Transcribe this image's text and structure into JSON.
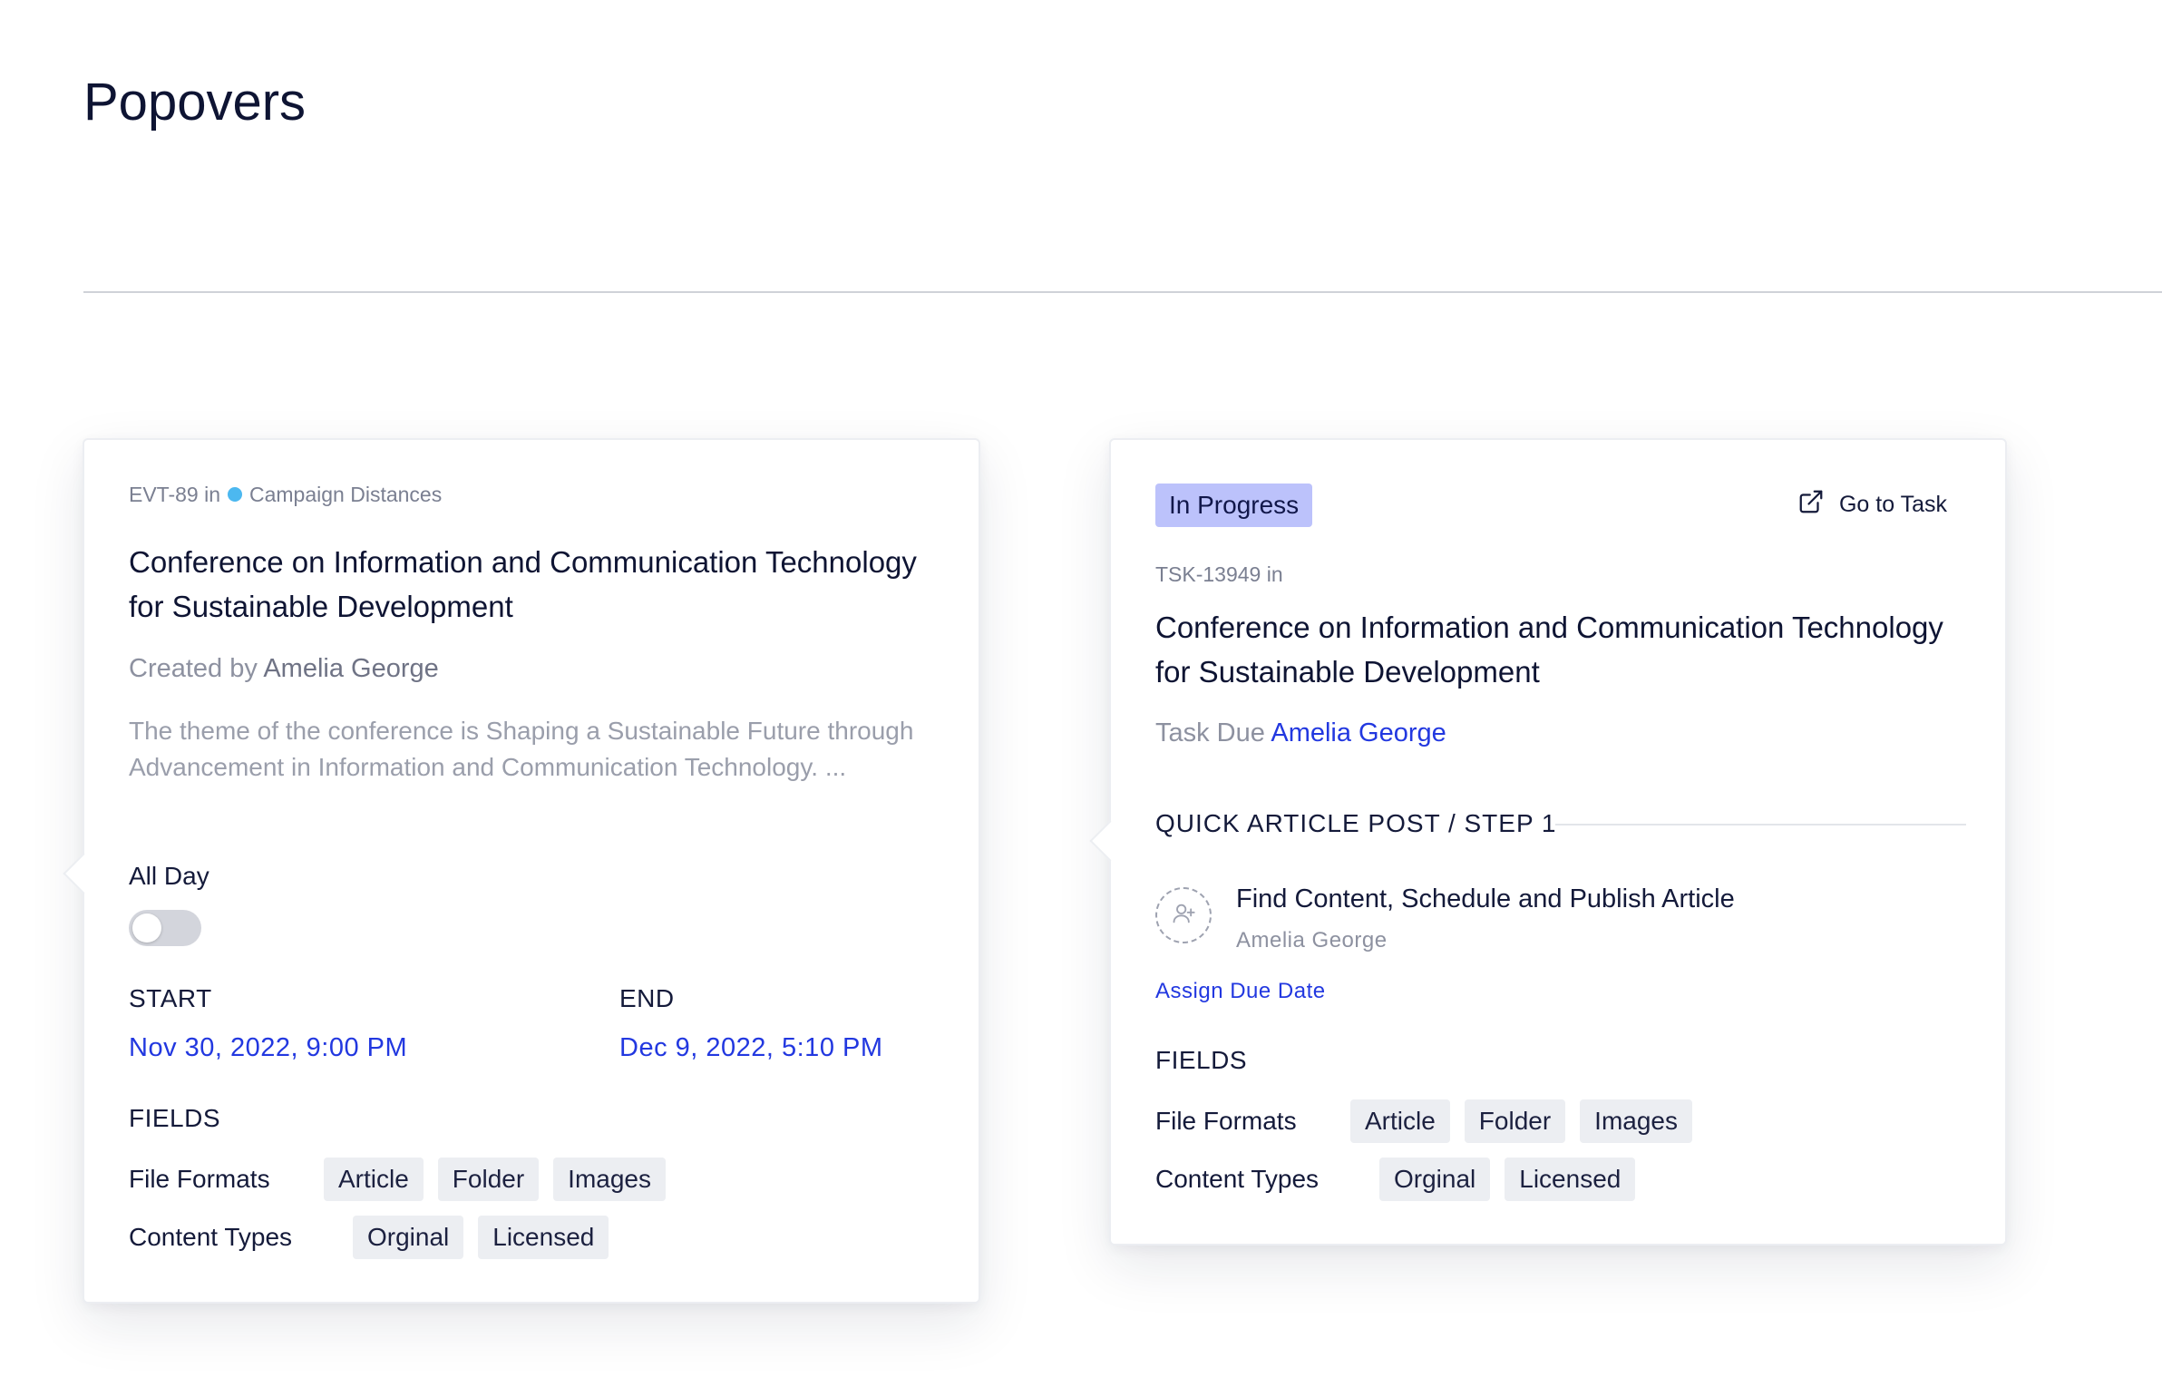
{
  "page": {
    "title": "Popovers"
  },
  "event_popover": {
    "event_id": "EVT-89 in",
    "campaign_name": "Campaign Distances",
    "campaign_color": "#4cb8f0",
    "title": "Conference on Information and Communication Technology for Sustainable Development",
    "created_by_label": "Created by",
    "created_by_name": "Amelia George",
    "description": "The theme of the conference is Shaping a Sustainable Future through Advancement in Information and Communication Technology. ...",
    "all_day_label": "All Day",
    "all_day_enabled": false,
    "start_label": "START",
    "start_value": "Nov 30, 2022, 9:00 PM",
    "end_label": "END",
    "end_value": "Dec 9, 2022, 5:10 PM",
    "fields_heading": "FIELDS",
    "file_formats_label": "File Formats",
    "file_formats": [
      "Article",
      "Folder",
      "Images"
    ],
    "content_types_label": "Content Types",
    "content_types": [
      "Orginal",
      "Licensed"
    ]
  },
  "task_popover": {
    "status": "In Progress",
    "status_color": "#bcc2fb",
    "go_to_task_label": "Go to Task",
    "task_id": "TSK-13949 in",
    "title": "Conference on Information and Communication Technology for Sustainable Development",
    "task_due_label": "Task Due",
    "task_due_name": "Amelia George",
    "step_label": "QUICK ARTICLE POST / STEP 1",
    "subtask_title": "Find Content, Schedule and Publish Article",
    "subtask_assignee": "Amelia George",
    "assign_due_date_label": "Assign Due Date",
    "fields_heading": "FIELDS",
    "file_formats_label": "File Formats",
    "file_formats": [
      "Article",
      "Folder",
      "Images"
    ],
    "content_types_label": "Content Types",
    "content_types": [
      "Orginal",
      "Licensed"
    ]
  },
  "icons": {
    "external_link": "external-link-icon",
    "add_user": "add-user-icon"
  },
  "colors": {
    "accent_blue": "#2238e0",
    "tag_background": "#eceef2"
  }
}
